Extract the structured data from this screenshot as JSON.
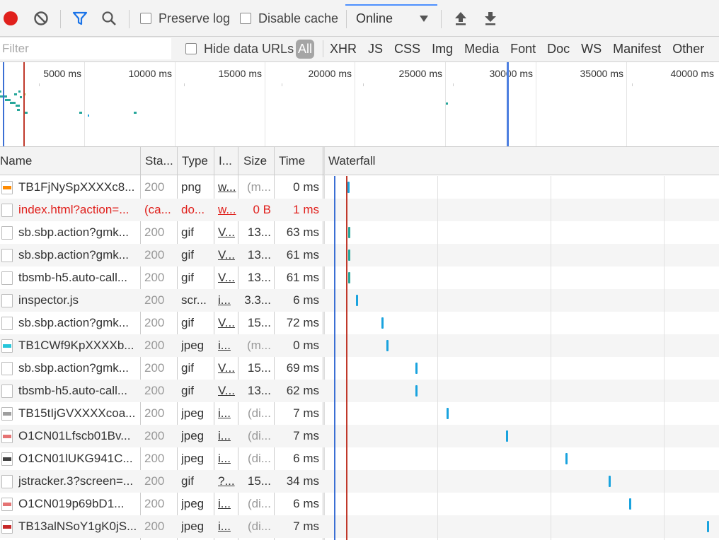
{
  "toolbar": {
    "preserve_log": "Preserve log",
    "disable_cache": "Disable cache",
    "throttle": "Online"
  },
  "filterbar": {
    "placeholder": "Filter",
    "hide_data_urls": "Hide data URLs",
    "types": [
      "All",
      "XHR",
      "JS",
      "CSS",
      "Img",
      "Media",
      "Font",
      "Doc",
      "WS",
      "Manifest",
      "Other"
    ]
  },
  "overview": {
    "ticks": [
      "5000 ms",
      "10000 ms",
      "15000 ms",
      "20000 ms",
      "25000 ms",
      "30000 ms",
      "35000 ms",
      "40000 ms"
    ]
  },
  "table": {
    "headers": {
      "name": "Name",
      "status": "Sta...",
      "type": "Type",
      "initiator": "I...",
      "size": "Size",
      "time": "Time",
      "waterfall": "Waterfall"
    },
    "rows": [
      {
        "name": "TB1FjNySpXXXXc8...",
        "status": "200",
        "type": "png",
        "initiator": "w...",
        "size": "(m...",
        "time": "0 ms"
      },
      {
        "name": "index.html?action=...",
        "status": "(ca...",
        "type": "do...",
        "initiator": "w...",
        "size": "0 B",
        "time": "1 ms"
      },
      {
        "name": "sb.sbp.action?gmk...",
        "status": "200",
        "type": "gif",
        "initiator": "V...",
        "size": "13...",
        "time": "63 ms"
      },
      {
        "name": "sb.sbp.action?gmk...",
        "status": "200",
        "type": "gif",
        "initiator": "V...",
        "size": "13...",
        "time": "61 ms"
      },
      {
        "name": "tbsmb-h5.auto-call...",
        "status": "200",
        "type": "gif",
        "initiator": "V...",
        "size": "13...",
        "time": "61 ms"
      },
      {
        "name": "inspector.js",
        "status": "200",
        "type": "scr...",
        "initiator": "i...",
        "size": "3.3...",
        "time": "6 ms"
      },
      {
        "name": "sb.sbp.action?gmk...",
        "status": "200",
        "type": "gif",
        "initiator": "V...",
        "size": "15...",
        "time": "72 ms"
      },
      {
        "name": "TB1CWf9KpXXXXb...",
        "status": "200",
        "type": "jpeg",
        "initiator": "i...",
        "size": "(m...",
        "time": "0 ms"
      },
      {
        "name": "sb.sbp.action?gmk...",
        "status": "200",
        "type": "gif",
        "initiator": "V...",
        "size": "15...",
        "time": "69 ms"
      },
      {
        "name": "tbsmb-h5.auto-call...",
        "status": "200",
        "type": "gif",
        "initiator": "V...",
        "size": "13...",
        "time": "62 ms"
      },
      {
        "name": "TB15tIjGVXXXXcoa...",
        "status": "200",
        "type": "jpeg",
        "initiator": "i...",
        "size": "(di...",
        "time": "7 ms"
      },
      {
        "name": "O1CN01Lfscb01Bv...",
        "status": "200",
        "type": "jpeg",
        "initiator": "i...",
        "size": "(di...",
        "time": "7 ms"
      },
      {
        "name": "O1CN01lUKG941C...",
        "status": "200",
        "type": "jpeg",
        "initiator": "i...",
        "size": "(di...",
        "time": "6 ms"
      },
      {
        "name": "jstracker.3?screen=...",
        "status": "200",
        "type": "gif",
        "initiator": "?...",
        "size": "15...",
        "time": "34 ms"
      },
      {
        "name": "O1CN019p69bD1...",
        "status": "200",
        "type": "jpeg",
        "initiator": "i...",
        "size": "(di...",
        "time": "6 ms"
      },
      {
        "name": "TB13alNSoY1gK0jS...",
        "status": "200",
        "type": "jpeg",
        "initiator": "i...",
        "size": "(di...",
        "time": "7 ms"
      }
    ]
  },
  "colors": {
    "record": "#e0201c",
    "error_text": "#e0201c",
    "waterfall_bar": "#1aa3de",
    "dom_content_loaded": "#3b6fd4",
    "load_event": "#c0392b",
    "accent": "#1a73e8"
  }
}
